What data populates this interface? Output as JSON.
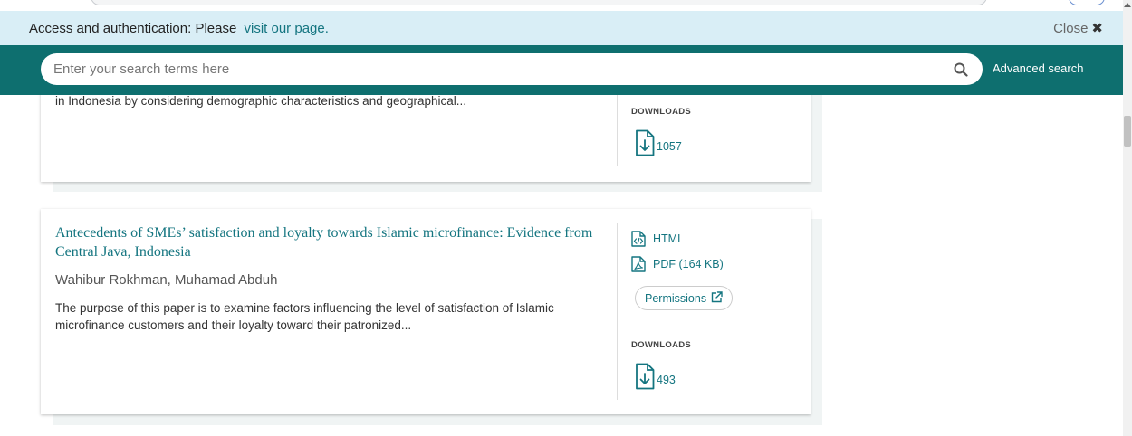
{
  "notice": {
    "text": "Access and authentication: Please",
    "link": "visit our page.",
    "close_label": "Close",
    "close_glyph": "✖"
  },
  "search": {
    "placeholder": "Enter your search terms here",
    "advanced_label": "Advanced search"
  },
  "results": [
    {
      "abstract_cut": "in Indonesia by considering demographic characteristics and geographical...",
      "downloads_label": "DOWNLOADS",
      "downloads": "1057"
    },
    {
      "title": "Antecedents of SMEs’ satisfaction and loyalty towards Islamic microfinance: Evidence from Central Java, Indonesia",
      "authors": "Wahibur Rokhman, Muhamad Abduh",
      "abstract": "The purpose of this paper is to examine factors influencing the level of satisfaction of Islamic microfinance customers and their loyalty toward their patronized...",
      "html_label": "HTML",
      "pdf_label": "PDF (164 KB)",
      "permissions_label": "Permissions",
      "downloads_label": "DOWNLOADS",
      "downloads": "493"
    }
  ],
  "colors": {
    "accent": "#147580",
    "search_bar": "#0e6f6f",
    "notice_bg": "#d9eef6"
  },
  "icons": [
    "search-icon",
    "close-icon",
    "html-file-icon",
    "pdf-file-icon",
    "external-link-icon",
    "download-icon"
  ]
}
